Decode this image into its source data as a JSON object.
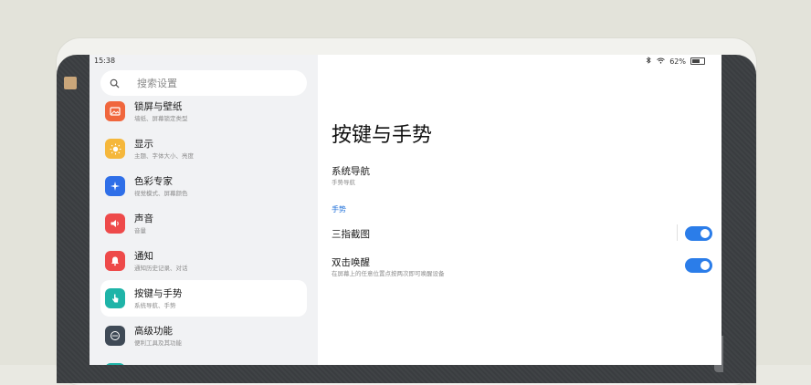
{
  "status_bar": {
    "time": "15:38",
    "battery": "62%"
  },
  "search": {
    "placeholder": "搜索设置"
  },
  "sidebar": {
    "items": [
      {
        "title": "锁屏与壁纸",
        "subtitle": "墙纸、屏幕锁定类型",
        "color": "#f0663d",
        "icon": "image-icon"
      },
      {
        "title": "显示",
        "subtitle": "主题、字体大小、亮度",
        "color": "#f5b73b",
        "icon": "sun-icon"
      },
      {
        "title": "色彩专家",
        "subtitle": "视觉模式、屏幕颜色",
        "color": "#2f6fe8",
        "icon": "sparkle-icon"
      },
      {
        "title": "声音",
        "subtitle": "音量",
        "color": "#ee4a4a",
        "icon": "speaker-icon"
      },
      {
        "title": "通知",
        "subtitle": "通知历史记录、对话",
        "color": "#ee4a4a",
        "icon": "bell-icon"
      },
      {
        "title": "按键与手势",
        "subtitle": "系统导航、手势",
        "color": "#1fb4a8",
        "icon": "hand-icon"
      },
      {
        "title": "高级功能",
        "subtitle": "便利工具及其功能",
        "color": "#3f4a56",
        "icon": "dots-icon"
      }
    ]
  },
  "content": {
    "title": "按键与手势",
    "system_nav": {
      "title": "系统导航",
      "subtitle": "手势导航"
    },
    "section": "手势",
    "three_finger": {
      "title": "三指截图",
      "enabled": true
    },
    "double_tap": {
      "title": "双击唤醒",
      "subtitle": "在屏幕上的任意位置点按两次即可唤醒设备",
      "enabled": true
    }
  },
  "colors": {
    "accent": "#2b7de9"
  }
}
